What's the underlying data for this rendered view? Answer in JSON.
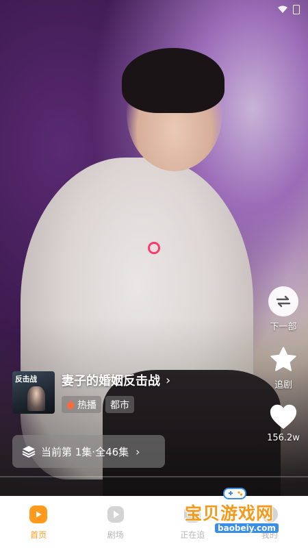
{
  "drama": {
    "poster_title": "反击战",
    "title": "妻子的婚姻反击战",
    "tags": [
      "热播",
      "都市"
    ],
    "episode_info": "当前第 1集·全46集",
    "progress": 0.0
  },
  "actions": {
    "next_label": "下一部",
    "follow_label": "追剧",
    "like_count": "156.2w"
  },
  "tabs": [
    {
      "label": "首页",
      "active": true
    },
    {
      "label": "剧场",
      "active": false
    },
    {
      "label": "正在追",
      "active": false
    },
    {
      "label": "我的",
      "active": false
    }
  ],
  "watermark": {
    "text": "宝贝游戏网",
    "url": "baobeiy.com"
  },
  "colors": {
    "accent": "#ff9a1f",
    "inactive_tab": "#b6b6b6",
    "focus_ring": "#ff3a6b"
  },
  "icons": [
    "wifi-icon",
    "battery-icon",
    "swap-icon",
    "star-icon",
    "heart-icon",
    "layers-icon",
    "fire-icon",
    "play-icon",
    "gamepad-icon"
  ]
}
